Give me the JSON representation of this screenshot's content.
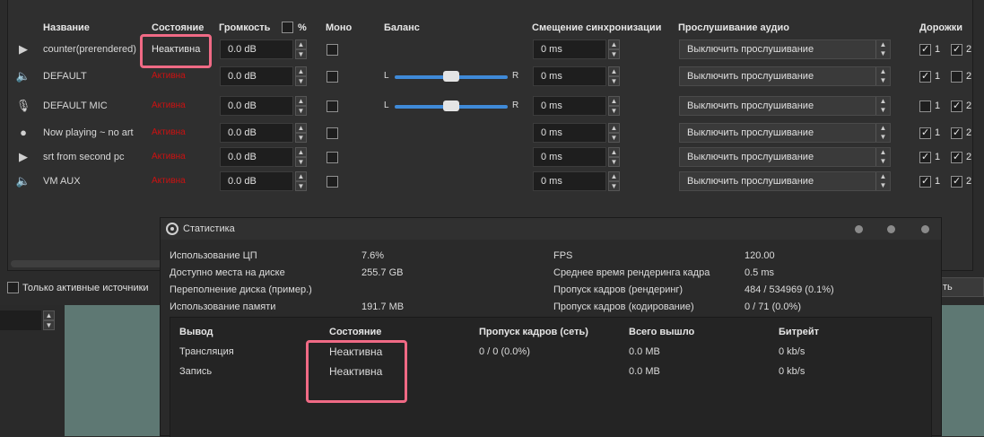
{
  "mixer": {
    "headers": {
      "name": "Название",
      "status": "Состояние",
      "volume": "Громкость",
      "percent": "%",
      "mono": "Моно",
      "balance": "Баланс",
      "sync": "Смещение синхронизации",
      "monitoring": "Прослушивание аудио",
      "tracks": "Дорожки"
    },
    "balance_left": "L",
    "balance_right": "R",
    "rows": [
      {
        "icon": "play-icon",
        "name": "counter(prerendered)",
        "status": "Неактивна",
        "volume": "0.0 dB",
        "mono": false,
        "balance": "",
        "sync": "0 ms",
        "monitor": "Выключить прослушивание",
        "track1": true,
        "track1_label": "1",
        "track2": true,
        "track2_label": "2"
      },
      {
        "icon": "speaker-icon",
        "name": "DEFAULT",
        "status": "Активна",
        "volume": "0.0 dB",
        "mono": false,
        "balance": "0.5",
        "sync": "0 ms",
        "monitor": "Выключить прослушивание",
        "track1": true,
        "track1_label": "1",
        "track2": false,
        "track2_label": "2"
      },
      {
        "icon": "microphone-icon",
        "name": "DEFAULT MIC",
        "status": "Активна",
        "volume": "0.0 dB",
        "mono": false,
        "balance": "0.5",
        "sync": "0 ms",
        "monitor": "Выключить прослушивание",
        "track1": false,
        "track1_label": "1",
        "track2": true,
        "track2_label": "2"
      },
      {
        "icon": "globe-icon",
        "name": "Now playing ~ no art",
        "status": "Активна",
        "volume": "0.0 dB",
        "mono": false,
        "balance": "",
        "sync": "0 ms",
        "monitor": "Выключить прослушивание",
        "track1": true,
        "track1_label": "1",
        "track2": true,
        "track2_label": "2"
      },
      {
        "icon": "play-icon",
        "name": "srt from second pc",
        "status": "Активна",
        "volume": "0.0 dB",
        "mono": false,
        "balance": "",
        "sync": "0 ms",
        "monitor": "Выключить прослушивание",
        "track1": true,
        "track1_label": "1",
        "track2": true,
        "track2_label": "2"
      },
      {
        "icon": "speaker-icon",
        "name": "VM AUX",
        "status": "Активна",
        "volume": "0.0 dB",
        "mono": false,
        "balance": "",
        "sync": "0 ms",
        "monitor": "Выключить прослушивание",
        "track1": true,
        "track1_label": "1",
        "track2": true,
        "track2_label": "2"
      }
    ],
    "only_active_label": "Только активные источники",
    "obscured_button_tail": "ть"
  },
  "stats": {
    "title": "Статистика",
    "left": [
      {
        "label": "Использование ЦП",
        "value": "7.6%"
      },
      {
        "label": "Доступно места на диске",
        "value": "255.7 GB"
      },
      {
        "label": "Переполнение диска (пример.)",
        "value": ""
      },
      {
        "label": "Использование памяти",
        "value": "191.7 MB"
      }
    ],
    "right": [
      {
        "label": "FPS",
        "value": "120.00"
      },
      {
        "label": "Среднее время рендеринга кадра",
        "value": "0.5 ms"
      },
      {
        "label": "Пропуск кадров (рендеринг)",
        "value": "484 / 534969 (0.1%)"
      },
      {
        "label": "Пропуск кадров (кодирование)",
        "value": "0 / 71 (0.0%)"
      }
    ],
    "outputs": {
      "headers": [
        "Вывод",
        "Состояние",
        "Пропуск кадров (сеть)",
        "Всего вышло",
        "Битрейт"
      ],
      "rows": [
        [
          "Трансляция",
          "Неактивна",
          "0 / 0 (0.0%)",
          "0.0 MB",
          "0 kb/s"
        ],
        [
          "Запись",
          "Неактивна",
          "",
          "0.0 MB",
          "0 kb/s"
        ]
      ]
    }
  },
  "colors": {
    "active_status": "#cc1111",
    "highlight": "#f06a85",
    "balance_slider": "#3f8ad8",
    "preview_background": "#5e7873"
  }
}
